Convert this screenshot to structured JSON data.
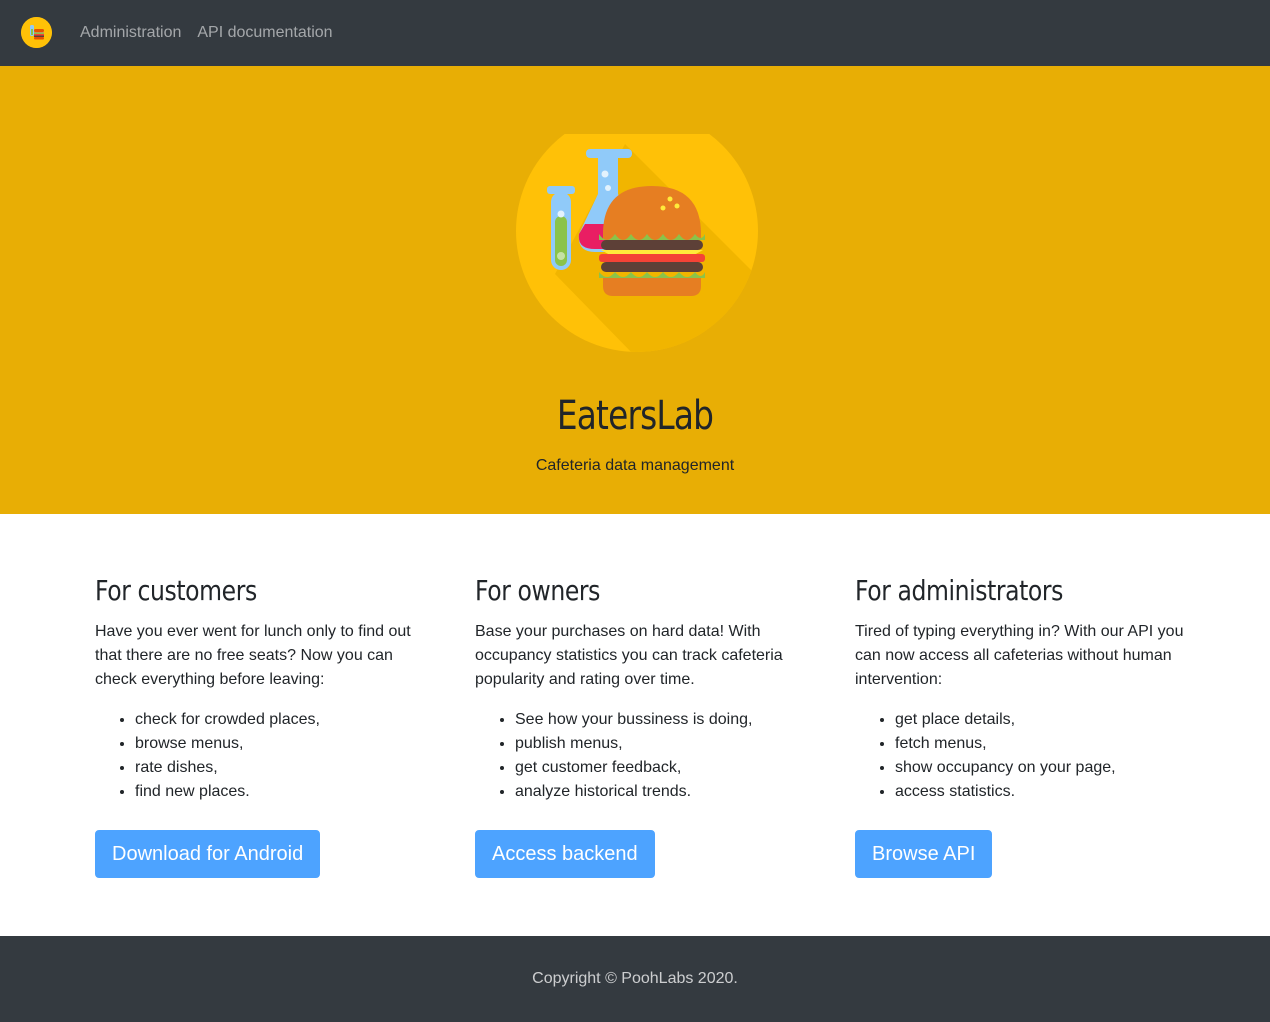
{
  "navbar": {
    "links": [
      {
        "label": "Administration"
      },
      {
        "label": "API documentation"
      }
    ]
  },
  "hero": {
    "title": "EatersLab",
    "subtitle": "Cafeteria data management"
  },
  "sections": [
    {
      "heading": "For customers",
      "text": "Have you ever went for lunch only to find out that there are no free seats? Now you can check everything before leaving:",
      "items": [
        "check for crowded places,",
        "browse menus,",
        "rate dishes,",
        "find new places."
      ],
      "button": "Download for Android"
    },
    {
      "heading": "For owners",
      "text": "Base your purchases on hard data! With occupancy statistics you can track cafeteria popularity and rating over time.",
      "items": [
        "See how your bussiness is doing,",
        "publish menus,",
        "get customer feedback,",
        "analyze historical trends."
      ],
      "button": "Access backend"
    },
    {
      "heading": "For administrators",
      "text": "Tired of typing everything in? With our API you can now access all cafeterias without human intervention:",
      "items": [
        "get place details,",
        "fetch menus,",
        "show occupancy on your page,",
        "access statistics."
      ],
      "button": "Browse API"
    }
  ],
  "footer": {
    "text": "Copyright © PoohLabs 2020."
  },
  "colors": {
    "navbar_bg": "#343a40",
    "hero_bg": "#e8ae05",
    "logo_circle": "#ffc107",
    "button_bg": "#4da3ff"
  }
}
